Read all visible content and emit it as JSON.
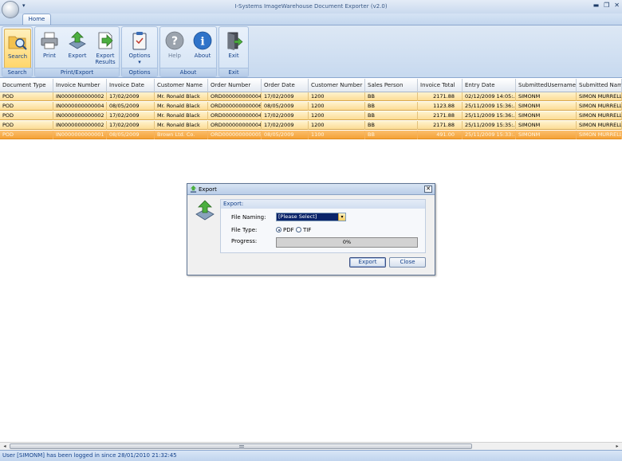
{
  "window": {
    "title": "I-Systems ImageWarehouse Document Exporter (v2.0)",
    "qat_glyph": "▾",
    "minimize": "▬",
    "restore": "❐",
    "close": "✕"
  },
  "ribbon": {
    "tab": "Home",
    "groups": {
      "search": "Search",
      "print_export": "Print/Export",
      "options": "Options",
      "about": "About",
      "exit": "Exit"
    },
    "buttons": {
      "search": "Search",
      "print": "Print",
      "export": "Export",
      "export_results_1": "Export",
      "export_results_2": "Results",
      "options": "Options",
      "options_arrow": "▾",
      "help": "Help",
      "about": "About",
      "exit": "Exit"
    },
    "icons": {
      "search": "folder-search-icon",
      "print": "printer-icon",
      "export": "export-arrow-icon",
      "export_results": "export-results-icon",
      "options": "clipboard-options-icon",
      "help": "help-icon",
      "about": "info-icon",
      "exit": "exit-door-icon"
    }
  },
  "grid": {
    "columns": [
      "Document Type",
      "Invoice Number",
      "Invoice Date",
      "Customer Name",
      "Order Number",
      "Order Date",
      "Customer Number",
      "Sales Person",
      "Invoice Total",
      "Entry Date",
      "SubmittedUsername",
      "Submitted Name"
    ],
    "rows": [
      [
        "POD",
        "IN0000000000002",
        "17/02/2009",
        "Mr. Ronald Black",
        "ORD000000000004",
        "17/02/2009",
        "1200",
        "BB",
        "2171.88",
        "02/12/2009 14:05:...",
        "SIMONM",
        "SIMON MURRELL"
      ],
      [
        "POD",
        "IN0000000000004",
        "08/05/2009",
        "Mr. Ronald Black",
        "ORD000000000006",
        "08/05/2009",
        "1200",
        "BB",
        "1123.88",
        "25/11/2009 15:36:...",
        "SIMONM",
        "SIMON MURRELL"
      ],
      [
        "POD",
        "IN0000000000002",
        "17/02/2009",
        "Mr. Ronald Black",
        "ORD000000000004",
        "17/02/2009",
        "1200",
        "BB",
        "2171.88",
        "25/11/2009 15:36:...",
        "SIMONM",
        "SIMON MURRELL"
      ],
      [
        "POD",
        "IN0000000000002",
        "17/02/2009",
        "Mr. Ronald Black",
        "ORD000000000004",
        "17/02/2009",
        "1200",
        "BB",
        "2171.88",
        "25/11/2009 15:35:...",
        "SIMONM",
        "SIMON MURRELL"
      ],
      [
        "POD",
        "IN0000000000001",
        "08/05/2009",
        "Brown Ltd. Co.",
        "ORD000000000005",
        "08/05/2009",
        "1100",
        "BB",
        "491.00",
        "25/11/2009 15:33:...",
        "SIMONM",
        "SIMON MURRELL"
      ]
    ],
    "selected_row": 4
  },
  "dialog": {
    "title": "Export",
    "close": "✕",
    "group_title": "Export:",
    "file_naming_label": "File Naming:",
    "file_naming_value": "[Please Select]",
    "combo_arrow": "▾",
    "file_type_label": "File Type:",
    "radio_pdf": "PDF",
    "radio_tif": "TIF",
    "file_type_selected": "PDF",
    "progress_label": "Progress:",
    "progress_text": "0%",
    "progress_value": 0,
    "export_button": "Export",
    "close_button": "Close"
  },
  "scrollbar": {
    "left": "◂",
    "right": "▸"
  },
  "status": "User [SIMONM] has been logged in since 28/01/2010 21:32:45",
  "colors": {
    "row_fill": "#fcdc95",
    "selected_row_fill": "#f5a237",
    "ribbon_text": "#15428b"
  }
}
